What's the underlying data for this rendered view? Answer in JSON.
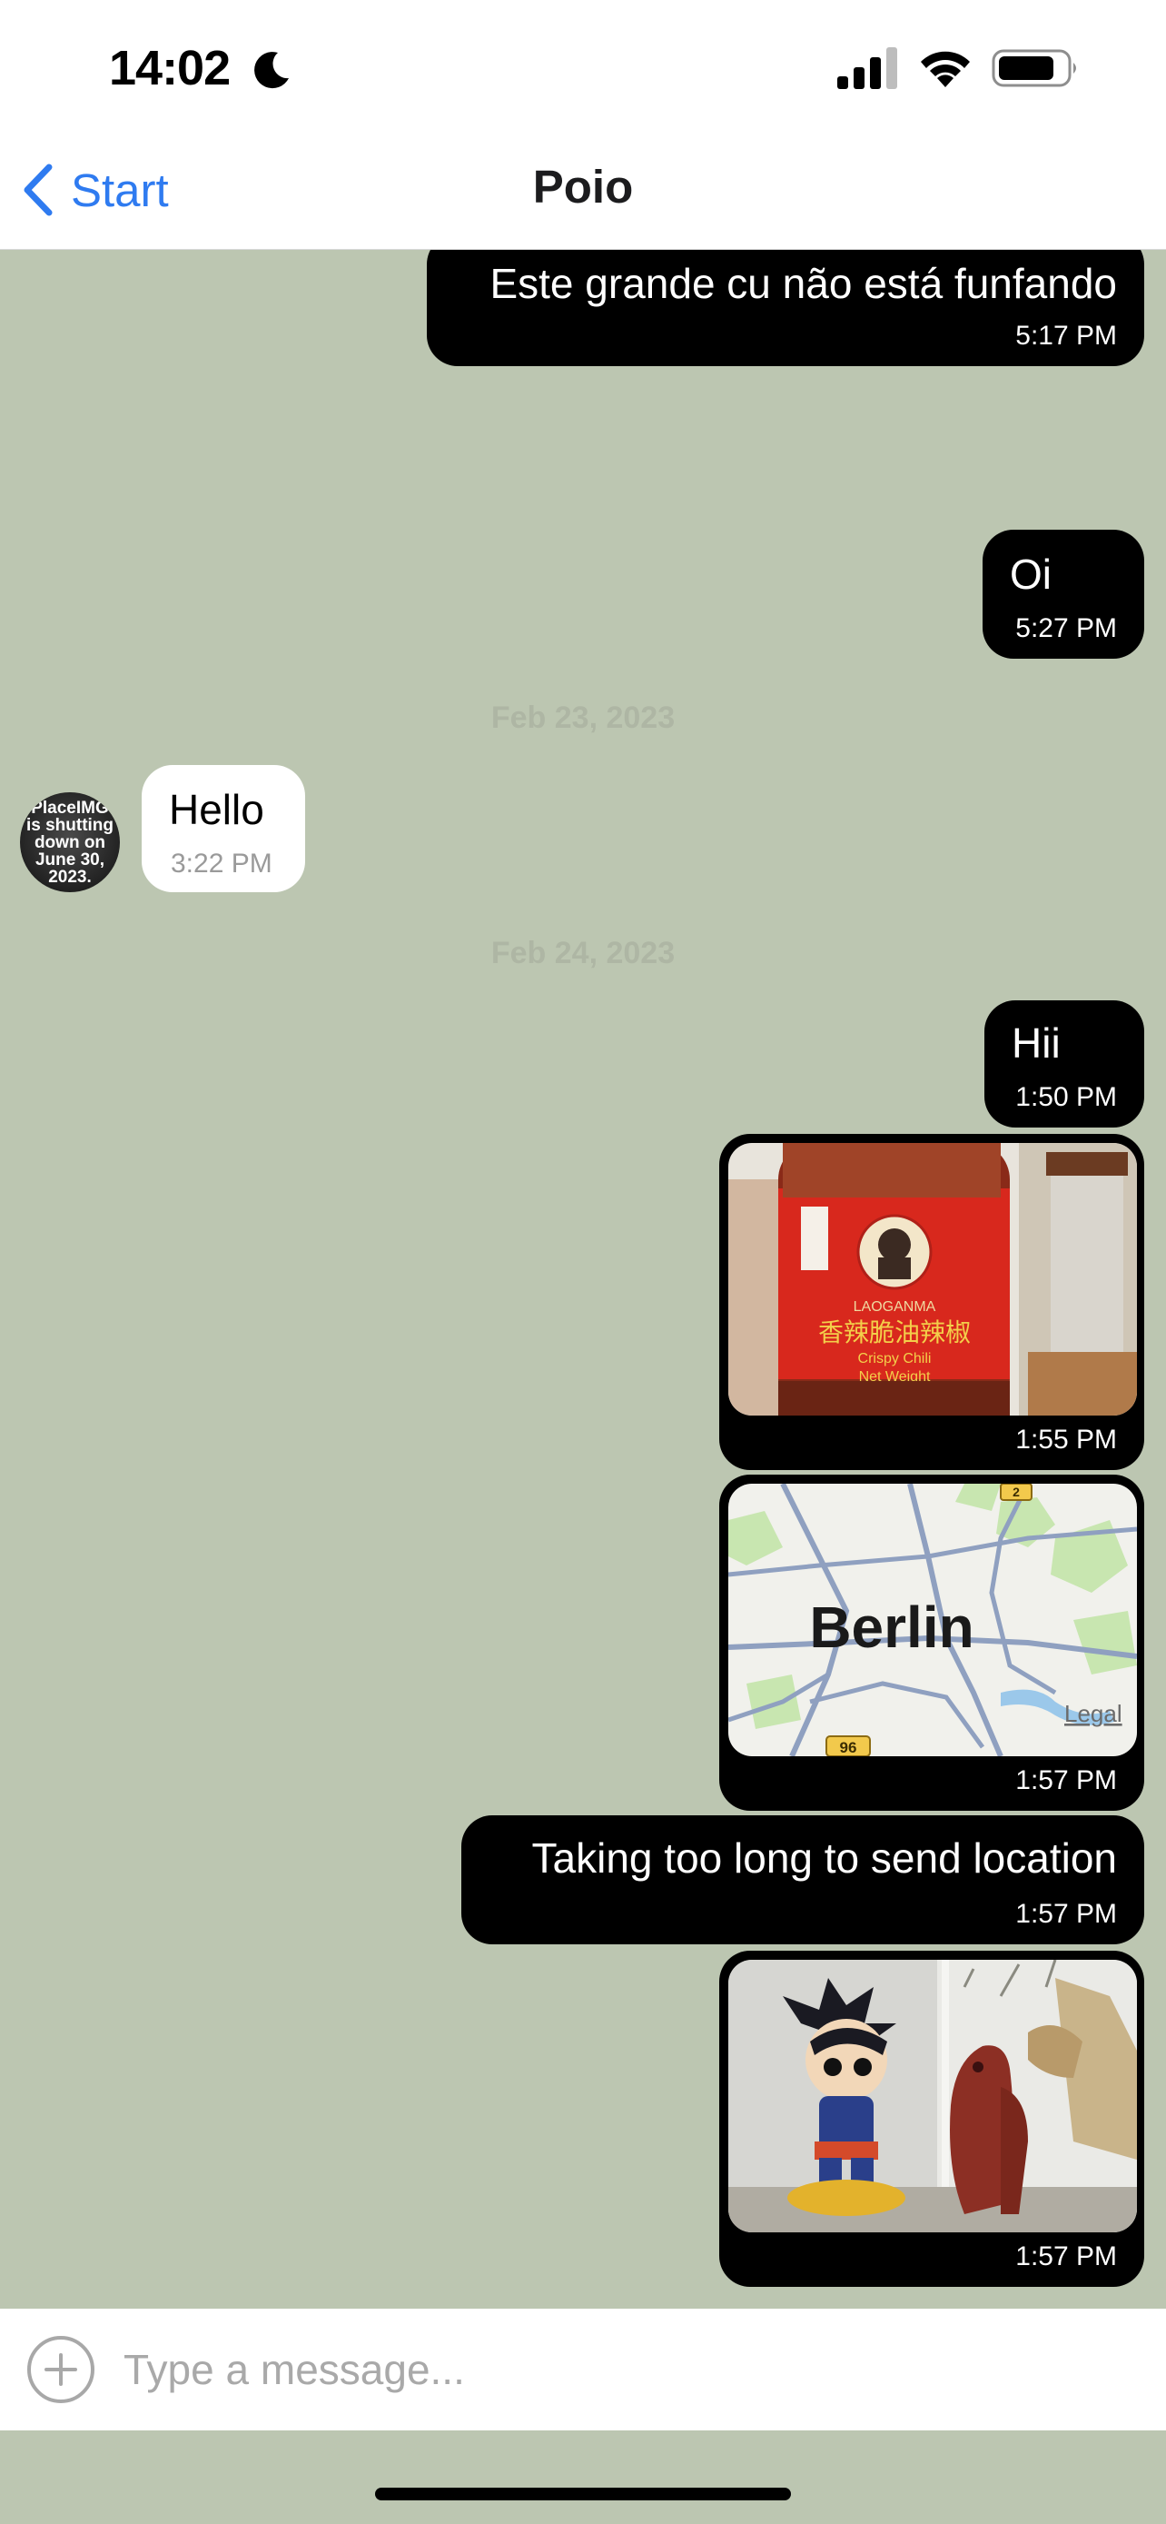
{
  "status_bar": {
    "time": "14:02",
    "icons": [
      "moon-icon",
      "cellular-signal-icon",
      "wifi-icon",
      "battery-icon"
    ]
  },
  "nav": {
    "back_label": "Start",
    "title": "Poio",
    "back_icon": "chevron-left-icon"
  },
  "colors": {
    "accent": "#2f7bf0",
    "chat_background": "#bcc6b1",
    "outgoing_bubble": "#000000",
    "incoming_bubble": "#ffffff"
  },
  "messages": [
    {
      "direction": "outgoing",
      "type": "text",
      "text": "Este grande cu não está funfando",
      "time": "5:17 PM"
    },
    {
      "direction": "outgoing",
      "type": "text",
      "text": "Oi",
      "time": "5:27 PM"
    },
    {
      "type": "date_separator",
      "text": "Feb 23, 2023"
    },
    {
      "direction": "incoming",
      "type": "text",
      "text": "Hello",
      "time": "3:22 PM",
      "avatar_text": "PlaceIMG is shutting down on June 30, 2023."
    },
    {
      "type": "date_separator",
      "text": "Feb 24, 2023"
    },
    {
      "direction": "outgoing",
      "type": "text",
      "text": "Hii",
      "time": "1:50 PM"
    },
    {
      "direction": "outgoing",
      "type": "image",
      "time": "1:55 PM",
      "image_text": [
        "LAOGANMA",
        "香辣脆油辣椒",
        "Crispy Chili",
        "Net Weight"
      ]
    },
    {
      "direction": "outgoing",
      "type": "location",
      "time": "1:57 PM",
      "map_city": "Berlin",
      "map_legal": "Legal",
      "map_road": "96",
      "map_road_top": "2"
    },
    {
      "direction": "outgoing",
      "type": "text",
      "text": "Taking too long to send location",
      "time": "1:57 PM"
    },
    {
      "direction": "outgoing",
      "type": "image",
      "time": "1:57 PM"
    }
  ],
  "composer": {
    "placeholder": "Type a message...",
    "value": "",
    "add_icon": "plus-circle-icon"
  }
}
